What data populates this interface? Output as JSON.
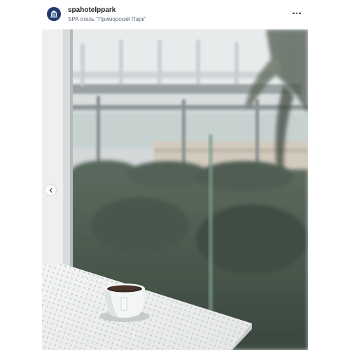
{
  "header": {
    "username": "spahotelppark",
    "location": "SPA отель \"Приморский Парк\""
  },
  "icons": {
    "avatar": "hotel-logo-icon",
    "more": "more-options-icon",
    "carousel_prev": "chevron-left-icon"
  },
  "colors": {
    "avatar_bg": "#1e3a6e",
    "text": "#262626",
    "subtext": "#5f6b7a"
  }
}
